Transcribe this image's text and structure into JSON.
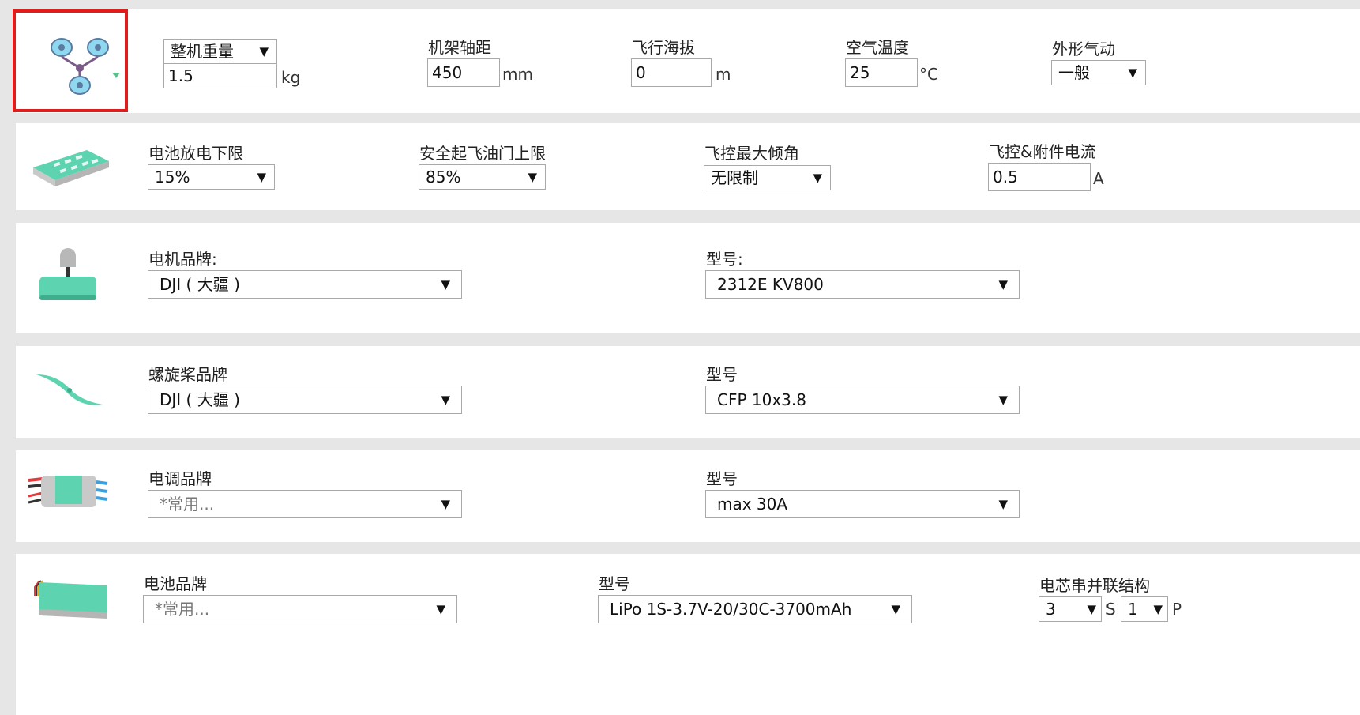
{
  "general": {
    "weight_mode": "整机重量",
    "weight_value": "1.5",
    "weight_unit": "kg",
    "frame_label": "机架轴距",
    "frame_value": "450",
    "frame_unit": "mm",
    "altitude_label": "飞行海拔",
    "altitude_value": "0",
    "altitude_unit": "m",
    "temp_label": "空气温度",
    "temp_value": "25",
    "temp_unit": "°C",
    "aero_label": "外形气动",
    "aero_value": "一般"
  },
  "limits": {
    "discharge_label": "电池放电下限",
    "discharge_value": "15%",
    "throttle_label": "安全起飞油门上限",
    "throttle_value": "85%",
    "tilt_label": "飞控最大倾角",
    "tilt_value": "无限制",
    "current_label": "飞控&附件电流",
    "current_value": "0.5",
    "current_unit": "A"
  },
  "motor": {
    "brand_label": "电机品牌:",
    "brand_value": "DJI ( 大疆 )",
    "model_label": "型号:",
    "model_value": "2312E KV800"
  },
  "propeller": {
    "brand_label": "螺旋桨品牌",
    "brand_value": "DJI ( 大疆 )",
    "model_label": "型号",
    "model_value": "CFP 10x3.8"
  },
  "esc": {
    "brand_label": "电调品牌",
    "brand_value": "*常用...",
    "model_label": "型号",
    "model_value": "max 30A"
  },
  "battery": {
    "brand_label": "电池品牌",
    "brand_value": "*常用...",
    "model_label": "型号",
    "model_value": "LiPo 1S-3.7V-20/30C-3700mAh",
    "cell_label": "电芯串并联结构",
    "series_value": "3",
    "series_unit": "S",
    "parallel_value": "1",
    "parallel_unit": "P"
  },
  "glyphs": {
    "dropdown_arrow": "▼"
  },
  "icons": [
    "quadcopter-icon",
    "flight-controller-icon",
    "motor-icon",
    "propeller-icon",
    "esc-icon",
    "battery-icon"
  ],
  "colors": {
    "accent": "#5dd3b0",
    "highlight_border": "#e21b1b"
  }
}
